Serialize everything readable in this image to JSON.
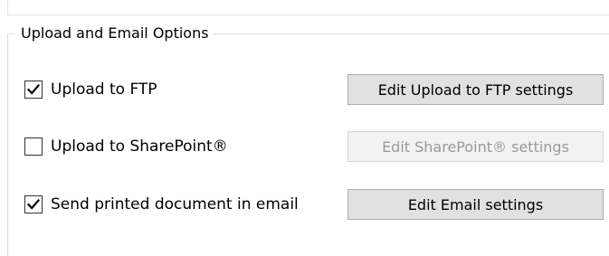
{
  "group": {
    "title": "Upload and Email Options"
  },
  "options": [
    {
      "label": "Upload to FTP",
      "checked": true,
      "button_label": "Edit Upload to FTP settings",
      "button_enabled": true
    },
    {
      "label": "Upload to SharePoint®",
      "checked": false,
      "button_label": "Edit SharePoint® settings",
      "button_enabled": false
    },
    {
      "label": "Send printed document in email",
      "checked": true,
      "button_label": "Edit Email settings",
      "button_enabled": true
    }
  ],
  "icons": {
    "checked": "checkmark-icon"
  },
  "colors": {
    "button_face": "#e1e1e1",
    "button_disabled_face": "#f2f2f2",
    "disabled_text": "#9a9a9a"
  }
}
